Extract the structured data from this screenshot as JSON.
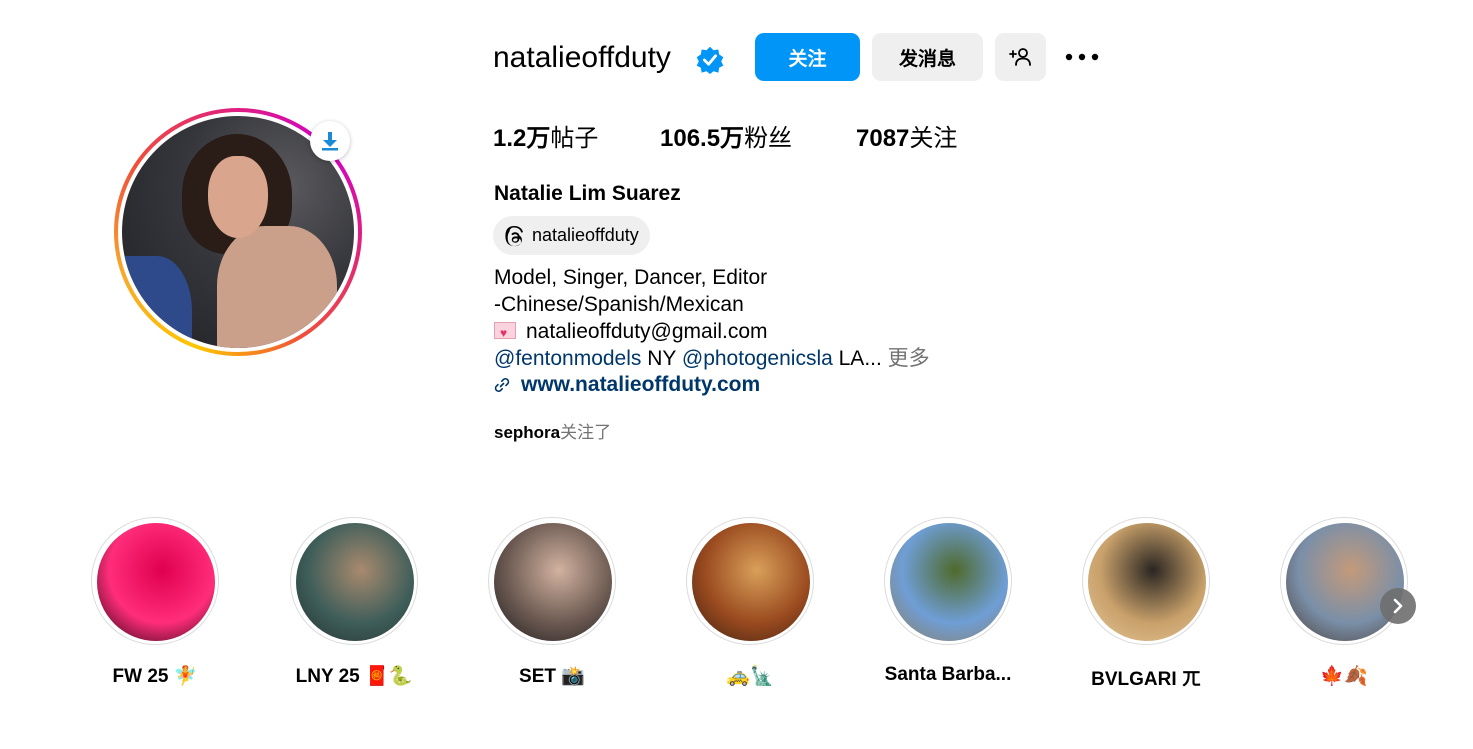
{
  "profile": {
    "username": "natalieoffduty",
    "full_name": "Natalie Lim Suarez",
    "verified_icon": "verified-badge-icon",
    "avatar_alt": "natalieoffduty profile photo"
  },
  "actions": {
    "follow_label": "关注",
    "message_label": "发消息",
    "add_user_icon": "add-user-icon",
    "more_icon": "more-horizontal-icon"
  },
  "stats": {
    "posts_count": "1.2万",
    "posts_label": "帖子",
    "followers_count": "106.5万",
    "followers_label": "粉丝",
    "following_count": "7087",
    "following_label": "关注"
  },
  "threads": {
    "handle": "natalieoffduty",
    "icon": "threads-icon"
  },
  "bio": {
    "line1": "Model, Singer, Dancer, Editor",
    "line2": "-Chinese/Spanish/Mexican",
    "email": "natalieoffduty@gmail.com",
    "mention1": "@fentonmodels",
    "mention1_suffix": " NY ",
    "mention2": "@photogenicsla",
    "mention2_suffix": " LA...",
    "more_label": "更多"
  },
  "website": {
    "url": "www.natalieoffduty.com",
    "icon": "link-icon"
  },
  "followed_by": {
    "user": "sephora",
    "suffix": "关注了"
  },
  "highlights": [
    {
      "label": "FW 25 🧚",
      "colors": [
        "#ff2d7a",
        "#e0004f",
        "#1a0008"
      ]
    },
    {
      "label": "LNY 25 🧧🐍",
      "colors": [
        "#3f5e5a",
        "#a98a6e",
        "#23302e"
      ]
    },
    {
      "label": "SET 📸",
      "colors": [
        "#6c5a52",
        "#d2b2a0",
        "#1c1a1c"
      ]
    },
    {
      "label": "🚕🗽",
      "colors": [
        "#9a4a1f",
        "#d9a05a",
        "#3a2012"
      ]
    },
    {
      "label": "Santa Barba...",
      "colors": [
        "#6f9ed6",
        "#4f6a2c",
        "#8c7b5a"
      ]
    },
    {
      "label": "BVLGARI ㄫ",
      "colors": [
        "#c8a06a",
        "#2a2622",
        "#e6c89a"
      ]
    },
    {
      "label": "🍁🍂",
      "colors": [
        "#7a8fa8",
        "#c49a7a",
        "#463a32"
      ]
    }
  ],
  "colors": {
    "primary_blue": "#0095f6",
    "link_blue": "#00376b",
    "secondary_grey": "#737373",
    "button_grey": "#efefef"
  }
}
